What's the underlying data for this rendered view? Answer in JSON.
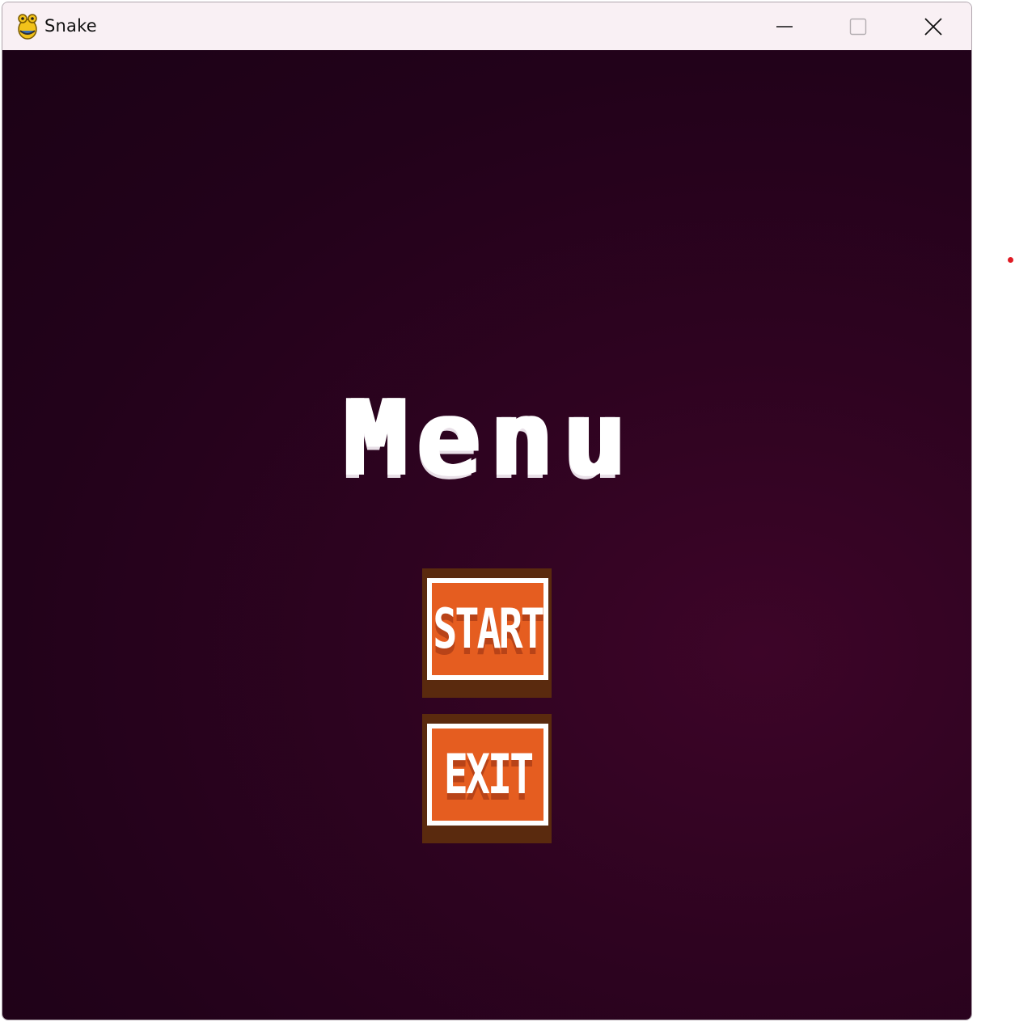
{
  "window": {
    "title": "Snake",
    "icon": "pygame-snake-icon"
  },
  "controls": {
    "minimize_icon": "minimize-icon",
    "maximize_icon": "maximize-icon",
    "close_icon": "close-icon"
  },
  "menu": {
    "title": "Menu",
    "buttons": [
      {
        "label": "START"
      },
      {
        "label": "EXIT"
      }
    ]
  },
  "colors": {
    "background": "#2a0320",
    "button_border": "#5a2a0e",
    "button_fill": "#e55d20",
    "title_text": "#ffffff"
  }
}
